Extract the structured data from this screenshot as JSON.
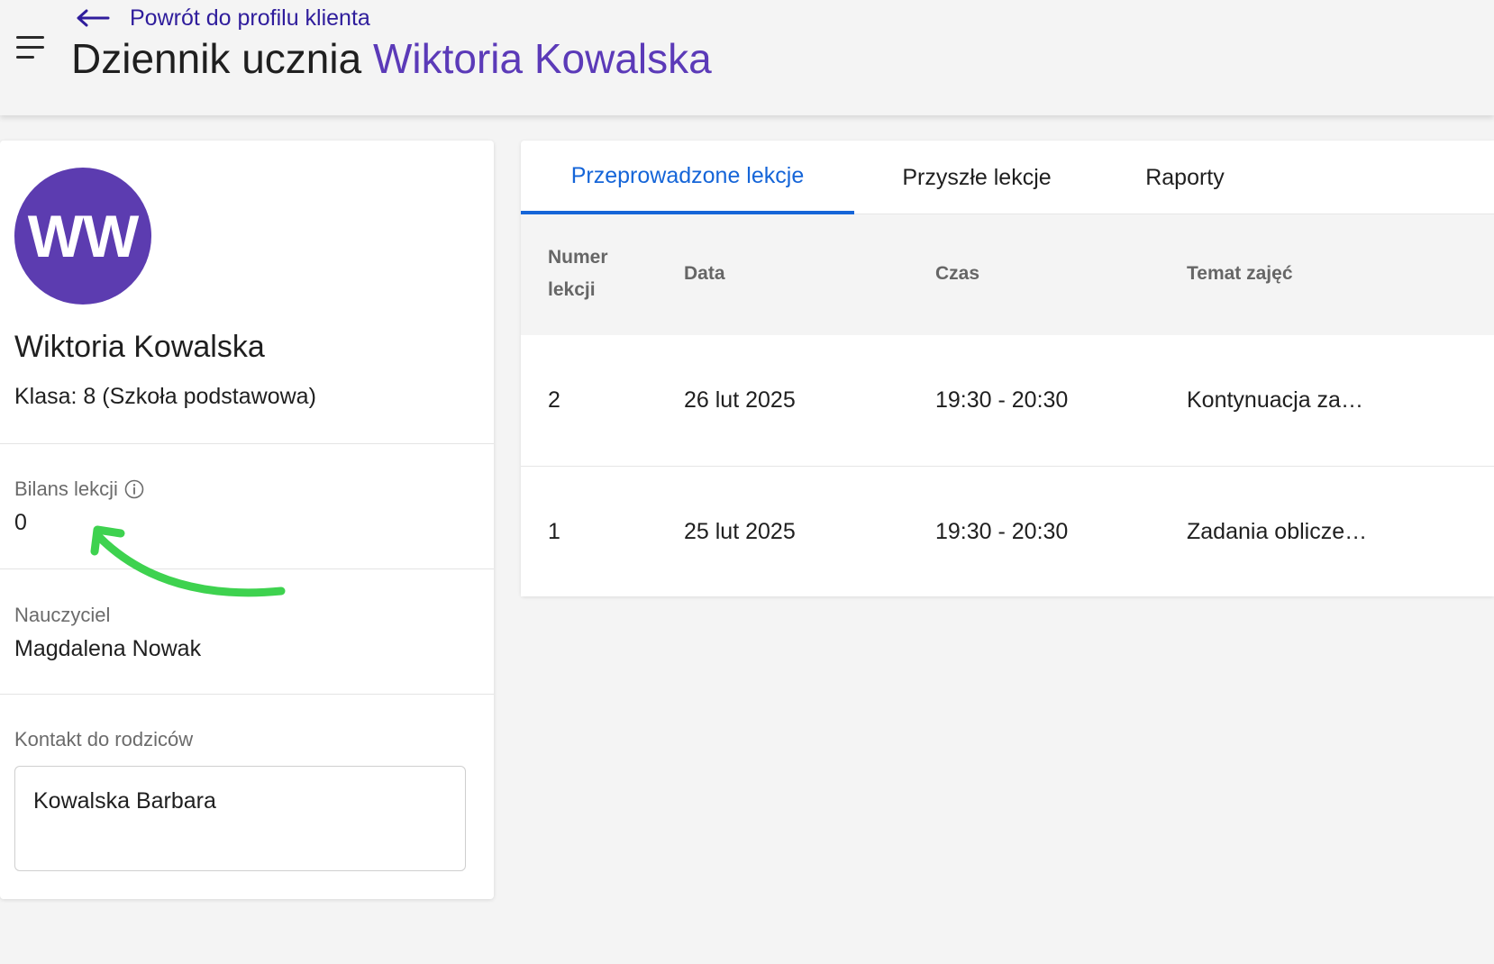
{
  "header": {
    "back_link_label": "Powrót do profilu klienta",
    "title_prefix": "Dziennik ucznia",
    "title_student": "Wiktoria Kowalska",
    "accent_color": "#5b3ab8",
    "back_link_color": "#2f1d9c"
  },
  "profile": {
    "avatar_initials": "WW",
    "avatar_color": "#5c3cb0",
    "name": "Wiktoria Kowalska",
    "class_line": "Klasa: 8 (Szkoła podstawowa)",
    "balance_label": "Bilans lekcji",
    "balance_value": "0",
    "teacher_label": "Nauczyciel",
    "teacher_value": "Magdalena Nowak",
    "contact_label": "Kontakt do rodziców",
    "contact_value": "Kowalska Barbara"
  },
  "tabs": [
    {
      "label": "Przeprowadzone lekcje",
      "active": true
    },
    {
      "label": "Przyszłe lekcje",
      "active": false
    },
    {
      "label": "Raporty",
      "active": false
    }
  ],
  "table": {
    "columns": [
      "Numer lekcji",
      "Data",
      "Czas",
      "Temat zajęć"
    ],
    "rows": [
      {
        "number": "2",
        "date": "26 lut 2025",
        "time": "19:30 - 20:30",
        "topic": "Kontynuacja za…"
      },
      {
        "number": "1",
        "date": "25 lut 2025",
        "time": "19:30 - 20:30",
        "topic": "Zadania oblicze…"
      }
    ]
  },
  "icons": {
    "menu": "hamburger-menu-icon",
    "back": "arrow-left-icon",
    "info": "info-circle-icon",
    "annotation": "green-curved-arrow"
  },
  "colors": {
    "tab_active": "#1565d8",
    "annotation_arrow": "#3ed24f"
  }
}
